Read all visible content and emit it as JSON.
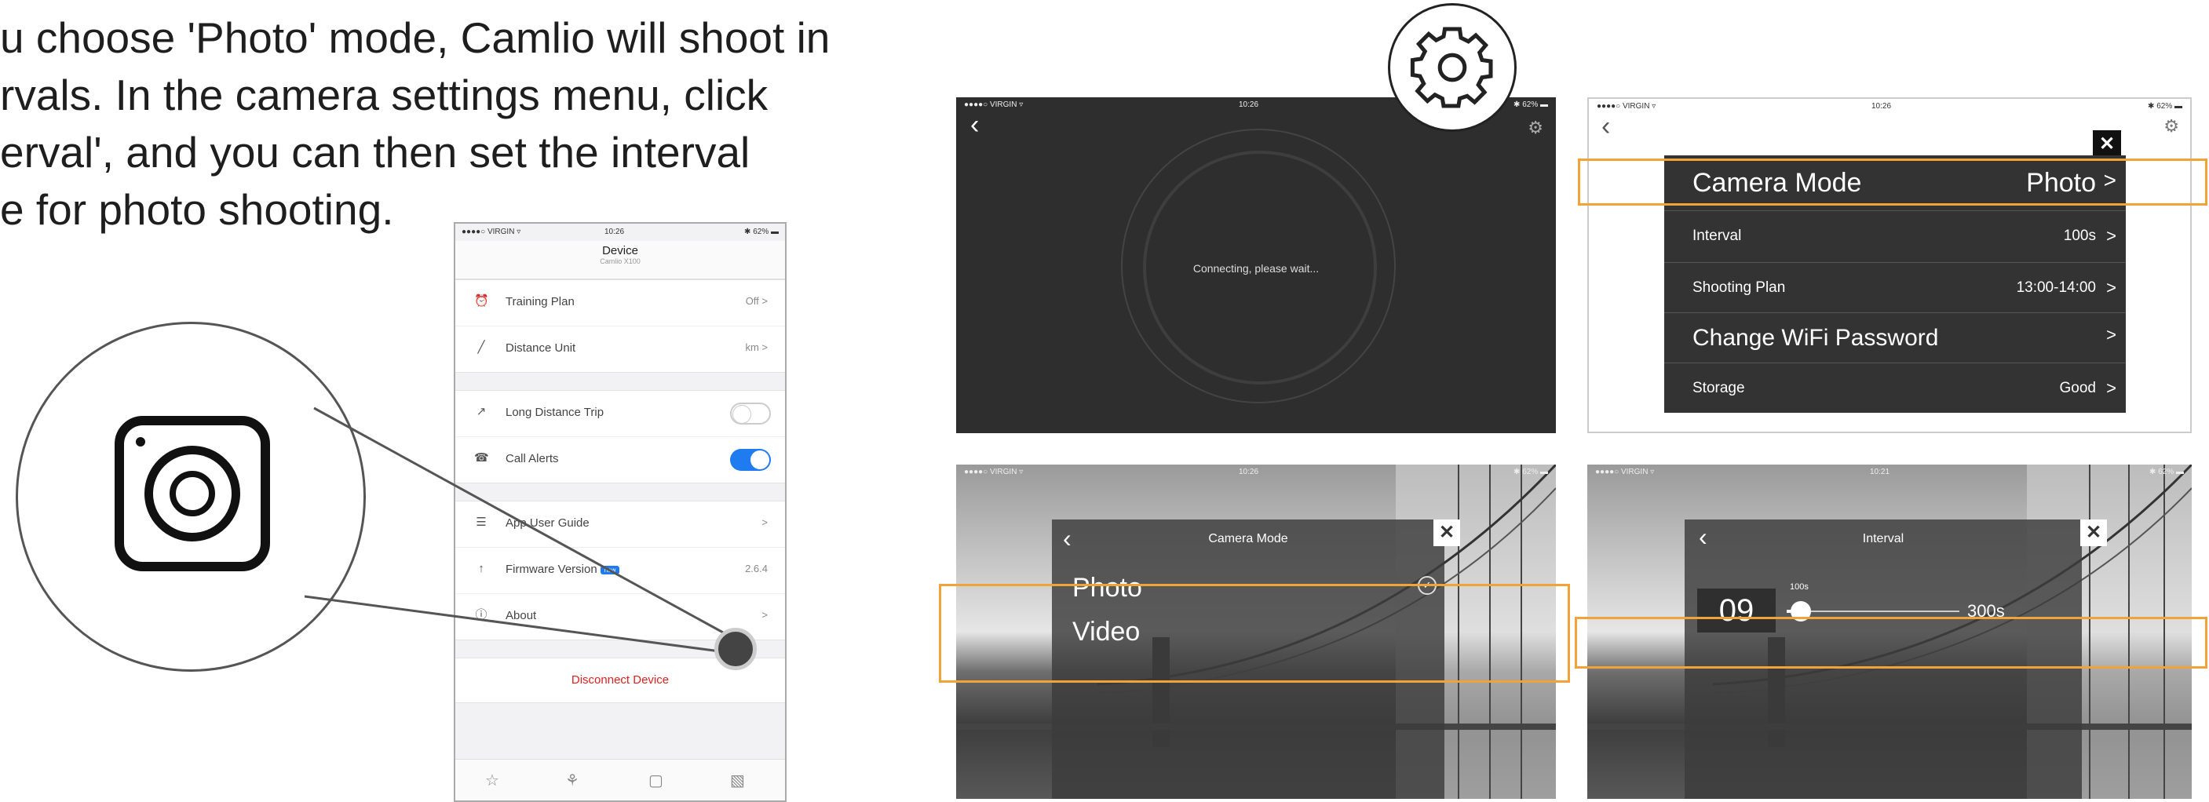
{
  "instructions": {
    "lines": [
      "u choose 'Photo' mode, Camlio will shoot in",
      "rvals. In the camera settings menu, click",
      "erval', and you can then  set the interval",
      "e for photo shooting."
    ]
  },
  "phone": {
    "status": {
      "carrier": "●●●●○ VIRGIN ▿",
      "time": "10:26",
      "battery": "✱ 62% ▬"
    },
    "header": {
      "title": "Device",
      "subtitle": "Camlio X100"
    },
    "group1": [
      {
        "icon": "⏰",
        "label": "Training Plan",
        "value": "Off >"
      },
      {
        "icon": "╱",
        "label": "Distance Unit",
        "value": "km >"
      }
    ],
    "group2": [
      {
        "icon": "↗",
        "label": "Long Distance Trip",
        "toggle": "off"
      },
      {
        "icon": "☎",
        "label": "Call Alerts",
        "toggle": "on"
      }
    ],
    "group3": [
      {
        "icon": "☰",
        "label": "App User Guide",
        "value": ">"
      },
      {
        "icon": "↑",
        "label": "Firmware Version",
        "badge": "new",
        "value": "2.6.4"
      },
      {
        "icon": "ⓘ",
        "label": "About",
        "value": ">"
      }
    ],
    "disconnect": "Disconnect Device",
    "tabs": [
      "☆",
      "⚘",
      "▢",
      "▧"
    ]
  },
  "screen1": {
    "status": {
      "carrier": "●●●●○ VIRGIN ▿",
      "time": "10:26",
      "battery": "✱ 62% ▬"
    },
    "back": "‹",
    "message": "Connecting, please wait...",
    "gear": "⚙"
  },
  "screen2": {
    "status": {
      "carrier": "●●●●○ VIRGIN ▿",
      "time": "10:26",
      "battery": "✱ 62% ▬"
    },
    "back": "‹",
    "close": "✕",
    "gear": "⚙",
    "menu": [
      {
        "label": "Camera Mode",
        "value": "Photo",
        "chev": ">"
      },
      {
        "label": "Interval",
        "value": "100s",
        "chev": ">"
      },
      {
        "label": "Shooting Plan",
        "value": "13:00-14:00",
        "chev": ">"
      },
      {
        "label": "Change WiFi Password",
        "value": "",
        "chev": ">"
      },
      {
        "label": "Storage",
        "value": "Good",
        "chev": ">"
      }
    ]
  },
  "screen3": {
    "status": {
      "carrier": "●●●●○ VIRGIN ▿",
      "time": "10:26",
      "battery": "✱ 62% ▬"
    },
    "close": "✕",
    "back": "‹",
    "title": "Camera Mode",
    "options": [
      "Photo",
      "Video"
    ],
    "check": "✓"
  },
  "screen4": {
    "status": {
      "carrier": "●●●●○ VIRGIN ▿",
      "time": "10:21",
      "battery": "✱ 62% ▬"
    },
    "close": "✕",
    "back": "‹",
    "title": "Interval",
    "value_box": "09",
    "slider_label": "100s",
    "slider_max": "300s",
    "slider_level": 0.08
  },
  "colors": {
    "highlight": "#f2a23b",
    "toggle_on": "#1e7bf0",
    "disconnect": "#e02020"
  },
  "icons": {
    "camera_mode": "camera-icon",
    "settings": "gear-icon"
  }
}
